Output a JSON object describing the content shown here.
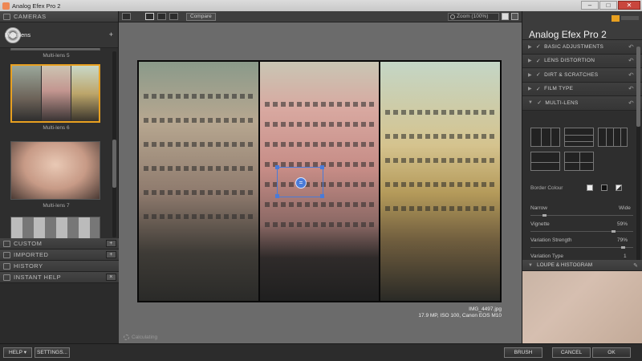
{
  "window": {
    "title": "Analog Efex Pro 2",
    "min_icon": "minimize-icon",
    "max_icon": "maximize-icon",
    "close_icon": "close-icon"
  },
  "left": {
    "cameras_title": "CAMERAS",
    "multilens_label": "Multi-lens",
    "thumbs": [
      {
        "label": "Multi-lens 5"
      },
      {
        "label": "Multi-lens 6",
        "selected": true
      },
      {
        "label": "Multi-lens 7"
      }
    ],
    "sections": [
      {
        "label": "CUSTOM",
        "button": "+"
      },
      {
        "label": "IMPORTED",
        "button": "+"
      },
      {
        "label": "HISTORY",
        "button": ""
      },
      {
        "label": "INSTANT HELP",
        "button": "×"
      }
    ]
  },
  "toolbar": {
    "compare_label": "Compare",
    "zoom_label": "Zoom (100%)"
  },
  "canvas": {
    "file_name": "IMG_4497.jpg",
    "file_meta": "17.9 MP, ISO 100, Canon EOS M10",
    "status": "Calculating"
  },
  "right": {
    "app_name": "Analog Efex Pro",
    "app_version": "2",
    "controls": [
      {
        "label": "BASIC ADJUSTMENTS",
        "expanded": false,
        "checked": true
      },
      {
        "label": "LENS DISTORTION",
        "expanded": false,
        "checked": true
      },
      {
        "label": "DIRT & SCRATCHES",
        "expanded": false,
        "checked": true
      },
      {
        "label": "FILM TYPE",
        "expanded": false,
        "checked": true
      },
      {
        "label": "MULTI-LENS",
        "expanded": true,
        "checked": true
      }
    ],
    "multilens": {
      "border_colour_label": "Border Colour",
      "narrow_label": "Narrow",
      "wide_label": "Wide",
      "border_width": 0.12,
      "vignette_label": "Vignette",
      "vignette_value": "59%",
      "variation_strength_label": "Variation Strength",
      "variation_strength_value": "79%",
      "variation_type_label": "Variation Type",
      "variation_type_value": "1"
    },
    "loupe_label": "LOUPE & HISTOGRAM"
  },
  "bottom": {
    "help_label": "HELP ▾",
    "settings_label": "SETTINGS...",
    "brush_label": "BRUSH",
    "cancel_label": "CANCEL",
    "ok_label": "OK"
  }
}
